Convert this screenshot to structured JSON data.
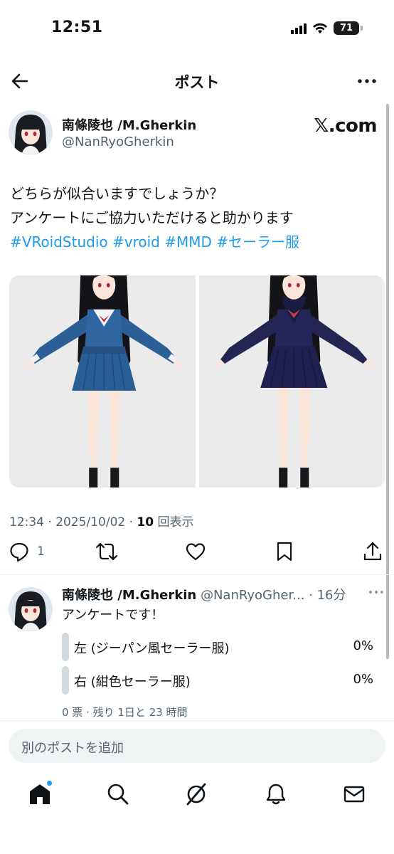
{
  "status_bar": {
    "time": "12:51",
    "battery": "71"
  },
  "header": {
    "title": "ポスト"
  },
  "tweet": {
    "author_name": "南條陵也 /M.Gherkin",
    "author_handle": "@NanRyoGherkin",
    "badge": "𝕏.com",
    "text_lines": [
      "どちらが似合いますでしょうか？",
      "アンケートにご協力いただけると助かります"
    ],
    "hashtags": [
      "#VRoidStudio",
      "#vroid",
      "#MMD",
      "#セーラー服"
    ],
    "meta": {
      "time": "12:34",
      "date": "2025/10/02",
      "views": "10",
      "views_label": "回表示"
    },
    "actions": {
      "replies": "1"
    }
  },
  "reply": {
    "author_name": "南條陵也 /M.Gherkin",
    "handle_truncated": "@NanRyoGher...",
    "time": "16分",
    "text": "アンケートです！",
    "poll": {
      "options": [
        {
          "label": "左 (ジーパン風セーラー服)",
          "percent": "0%"
        },
        {
          "label": "右 (紺色セーラー服)",
          "percent": "0%"
        }
      ],
      "summary": "0 票 · 残り 1日と 23 時間"
    }
  },
  "compose": {
    "placeholder": "別のポストを追加"
  },
  "colors": {
    "link": "#1d9bf0",
    "muted": "#536471",
    "text": "#0f1419",
    "skirt_left": "#2a5f95",
    "skirt_right": "#1e2150"
  },
  "icons": [
    "back-arrow-icon",
    "more-icon",
    "reply-icon",
    "repost-icon",
    "like-icon",
    "bookmark-icon",
    "share-icon",
    "home-icon",
    "search-icon",
    "grok-icon",
    "notifications-icon",
    "messages-icon"
  ]
}
